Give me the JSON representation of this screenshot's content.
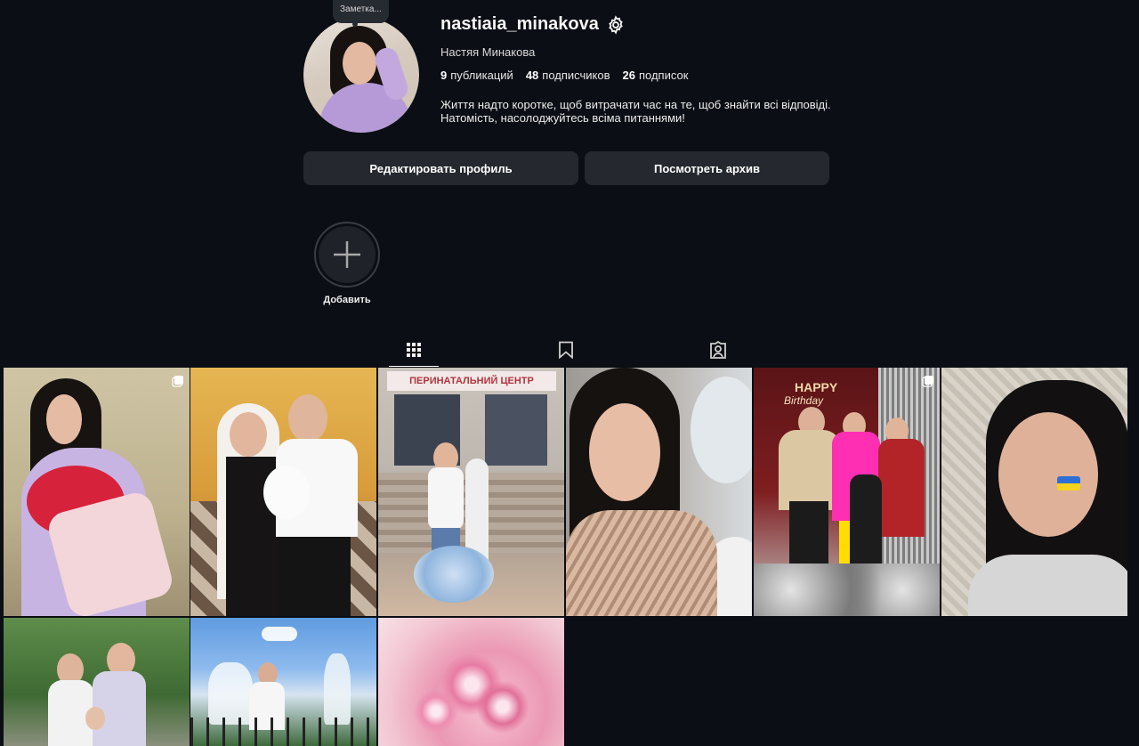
{
  "profile": {
    "note": "Заметка...",
    "username": "nastiaia_minakova",
    "full_name": "Настяя Минакова",
    "stats": {
      "posts_count": "9",
      "posts_label": "публикаций",
      "followers_count": "48",
      "followers_label": "подписчиков",
      "following_count": "26",
      "following_label": "подписок"
    },
    "bio_line1": "Життя надто коротке, щоб витрачати час на те, щоб знайти всі відповіді.",
    "bio_line2": "Натомість, насолоджуйтесь всіма питаннями!"
  },
  "buttons": {
    "edit_profile": "Редактировать профиль",
    "view_archive": "Посмотреть архив"
  },
  "highlights": {
    "add_label": "Добавить"
  },
  "tabs": [
    {
      "name": "posts",
      "icon": "grid-icon",
      "active": true
    },
    {
      "name": "saved",
      "icon": "bookmark-icon",
      "active": false
    },
    {
      "name": "tagged",
      "icon": "tagged-person-icon",
      "active": false
    }
  ],
  "posts_visible": 9,
  "signage": {
    "perinatal": "ПЕРИНАТАЛЬНИЙ ЦЕНТР",
    "happy": "HAPPY",
    "birthday": "Birthday"
  },
  "colors": {
    "background": "#0b0e14",
    "button_bg": "#25292f",
    "text": "#f5f5f5"
  }
}
